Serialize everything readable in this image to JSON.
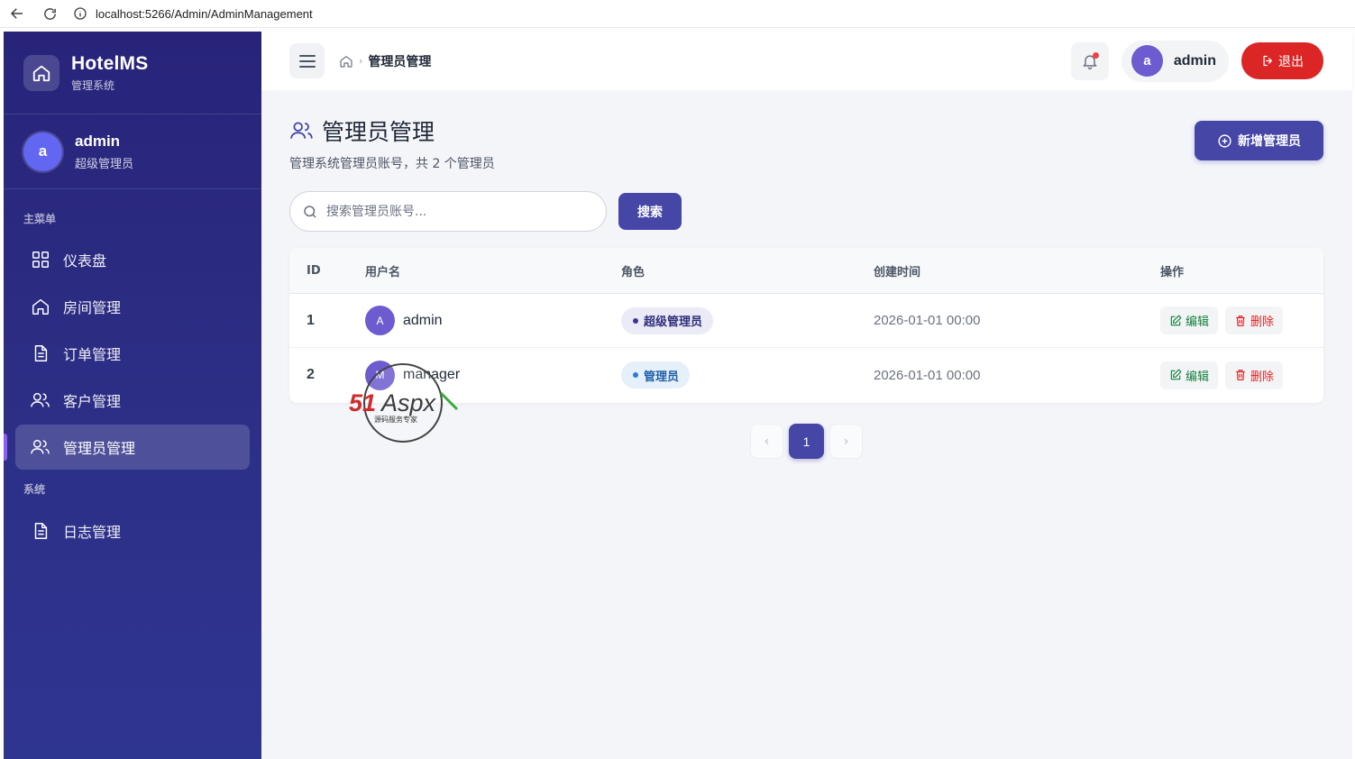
{
  "browser": {
    "url": "localhost:5266/Admin/AdminManagement"
  },
  "sidebar": {
    "brand_title": "HotelMS",
    "brand_sub": "管理系统",
    "user_avatar": "a",
    "user_name": "admin",
    "user_role": "超级管理员",
    "section_main": "主菜单",
    "section_system": "系统",
    "items": [
      {
        "label": "仪表盘",
        "icon": "grid-icon"
      },
      {
        "label": "房间管理",
        "icon": "home-icon"
      },
      {
        "label": "订单管理",
        "icon": "document-icon"
      },
      {
        "label": "客户管理",
        "icon": "users-icon"
      },
      {
        "label": "管理员管理",
        "icon": "users-icon",
        "active": true
      }
    ],
    "system_items": [
      {
        "label": "日志管理",
        "icon": "document-icon"
      }
    ]
  },
  "topbar": {
    "breadcrumb_current": "管理员管理",
    "user_avatar": "a",
    "user_name": "admin",
    "logout_label": "退出",
    "has_notification": true
  },
  "page": {
    "title": "管理员管理",
    "subtitle": "管理系统管理员账号，共 2 个管理员",
    "add_button": "新增管理员",
    "search_placeholder": "搜索管理员账号...",
    "search_button": "搜索"
  },
  "table": {
    "headers": {
      "id": "ID",
      "username": "用户名",
      "role": "角色",
      "created": "创建时间",
      "actions": "操作"
    },
    "rows": [
      {
        "id": "1",
        "avatar": "A",
        "username": "admin",
        "role": "超级管理员",
        "created": "2026-01-01 00:00",
        "edit": "编辑",
        "delete": "删除"
      },
      {
        "id": "2",
        "avatar": "M",
        "username": "manager",
        "role": "管理员",
        "created": "2026-01-01 00:00",
        "edit": "编辑",
        "delete": "删除"
      }
    ]
  },
  "pagination": {
    "prev": "‹",
    "current": "1",
    "next": "›"
  },
  "watermark": {
    "text": "51Aspx",
    "sub": "源码服务专家"
  },
  "colors": {
    "sidebar_bg": "#2d2f86",
    "accent": "#4546a6",
    "danger": "#dc2626",
    "success": "#15803d"
  }
}
